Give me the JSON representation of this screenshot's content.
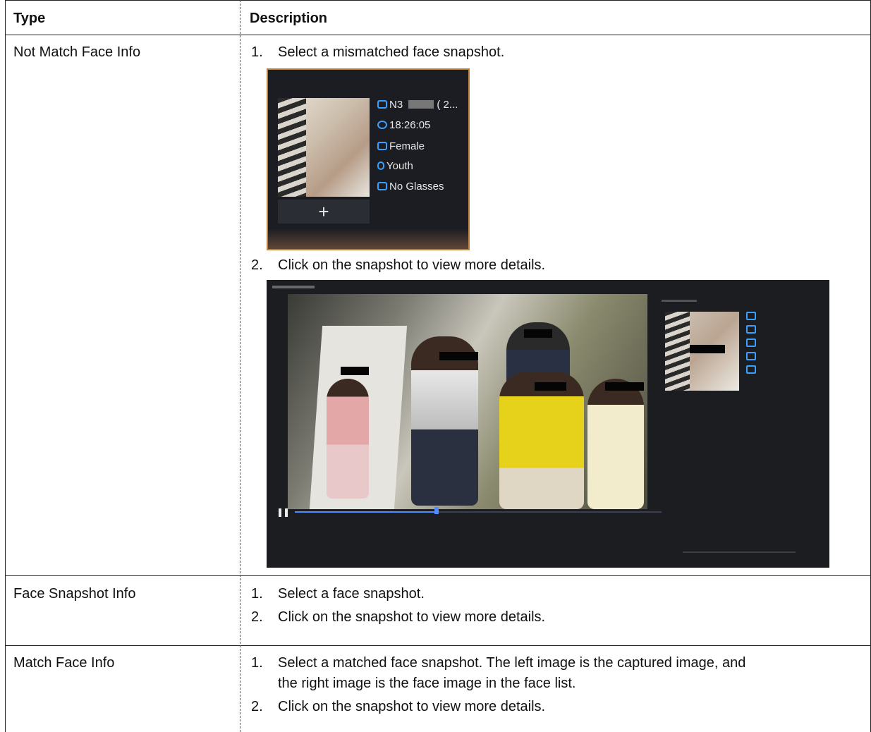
{
  "table": {
    "headers": {
      "type": "Type",
      "description": "Description"
    },
    "rows": [
      {
        "type": "Not Match Face Info",
        "steps": [
          {
            "num": "1.",
            "text": "Select a mismatched face snapshot."
          },
          {
            "num": "2.",
            "text": "Click on the snapshot to view more details."
          }
        ],
        "snapshot": {
          "channel": "N3",
          "channel_suffix": "( 2...",
          "time": "18:26:05",
          "gender": "Female",
          "age": "Youth",
          "glasses": "No Glasses",
          "add_symbol": "+"
        }
      },
      {
        "type": "Face Snapshot Info",
        "steps": [
          {
            "num": "1.",
            "text": "Select a face snapshot."
          },
          {
            "num": "2.",
            "text": "Click on the snapshot to view more details."
          }
        ]
      },
      {
        "type": "Match Face Info",
        "steps": [
          {
            "num": "1.",
            "text": "Select a matched face snapshot. The left image is the captured image, and",
            "text_cont": "the right image is the face image in the face list."
          },
          {
            "num": "2.",
            "text": "Click on the snapshot to view more details."
          }
        ]
      }
    ]
  },
  "colors": {
    "snapshot_border": "#b8823a",
    "icon_blue": "#3aa0ff",
    "progress_blue": "#4e8cff"
  }
}
